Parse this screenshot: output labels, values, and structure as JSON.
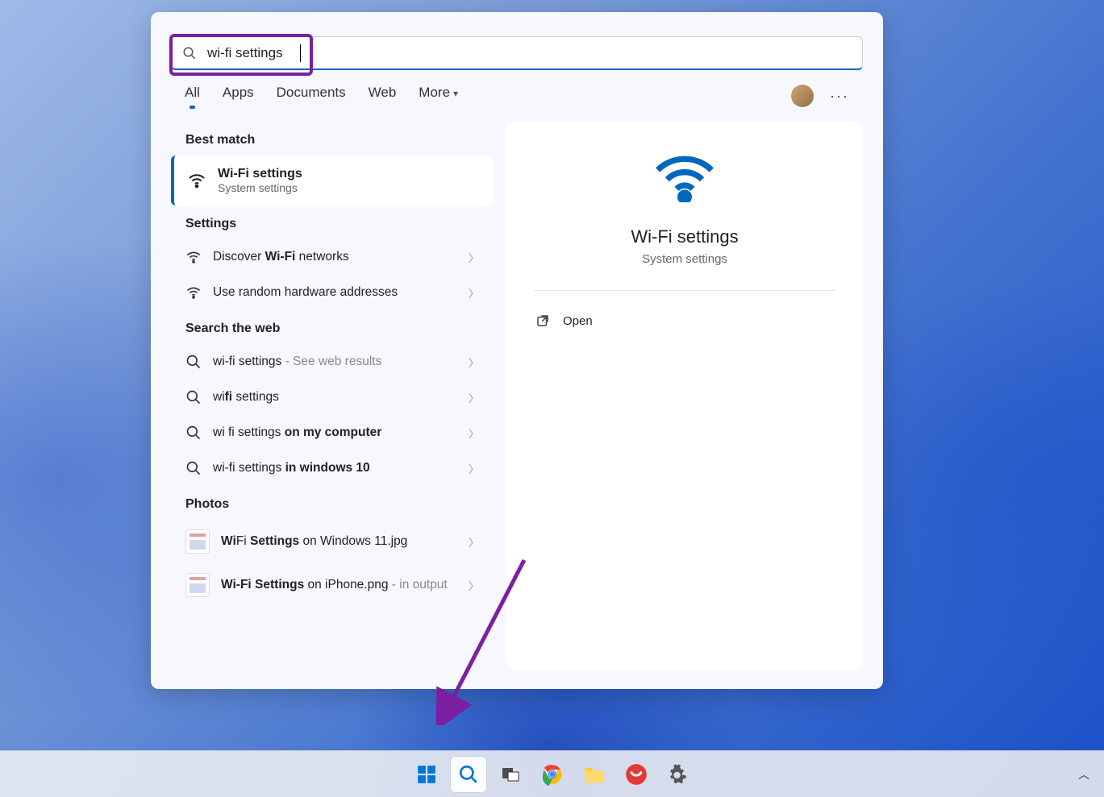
{
  "search": {
    "value": "wi-fi settings"
  },
  "tabs": {
    "all": "All",
    "apps": "Apps",
    "documents": "Documents",
    "web": "Web",
    "more": "More"
  },
  "sections": {
    "best_match": "Best match",
    "settings": "Settings",
    "search_web": "Search the web",
    "photos": "Photos"
  },
  "best_match": {
    "title": "Wi-Fi settings",
    "subtitle": "System settings"
  },
  "settings_items": {
    "r0_pre": "Discover ",
    "r0_b": "Wi-Fi",
    "r0_post": " networks",
    "r1": "Use random hardware addresses"
  },
  "web_items": {
    "w0_text": "wi-fi settings",
    "w0_suffix": " - See web results",
    "w1_pre": "wi",
    "w1_b": "fi",
    "w1_post": " settings",
    "w2_pre": "wi fi settings ",
    "w2_b": "on my computer",
    "w3_pre": "wi-fi settings ",
    "w3_b": "in windows 10"
  },
  "photos_items": {
    "p0_b1": "Wi",
    "p0_mid": "Fi ",
    "p0_b2": "Settings",
    "p0_post": " on Windows 11.jpg",
    "p1_b": "Wi-Fi Settings",
    "p1_mid": " on iPhone.png",
    "p1_suffix": " - in output"
  },
  "preview": {
    "title": "Wi-Fi settings",
    "subtitle": "System settings",
    "open": "Open"
  },
  "taskbar": {
    "start": "start-button",
    "search": "search-button",
    "taskview": "task-view-button",
    "chrome": "chrome",
    "explorer": "file-explorer",
    "app1": "pinned-app",
    "settings": "settings"
  }
}
